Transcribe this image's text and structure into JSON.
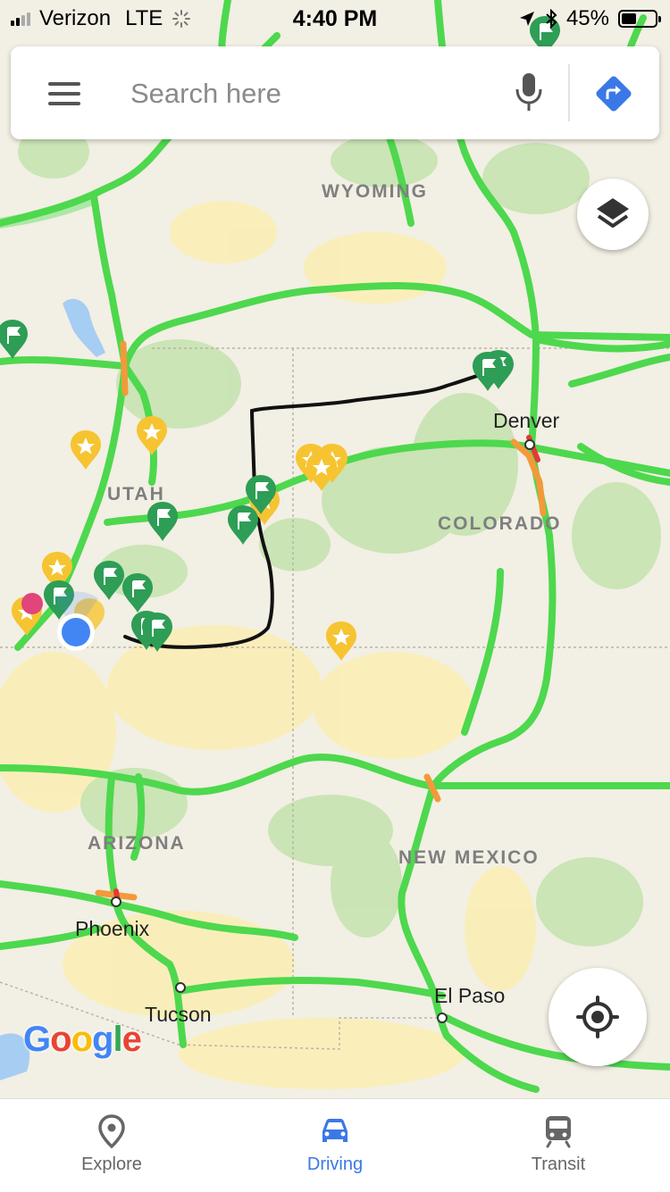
{
  "status_bar": {
    "carrier": "Verizon",
    "network": "LTE",
    "time": "4:40 PM",
    "battery": "45%",
    "battery_level": 0.45
  },
  "search": {
    "placeholder": "Search here"
  },
  "map": {
    "region_labels": {
      "wyoming": "WYOMING",
      "utah": "UTAH",
      "colorado": "COLORADO",
      "arizona": "ARIZONA",
      "new_mexico": "NEW MEXICO"
    },
    "cities": {
      "denver": "Denver",
      "phoenix": "Phoenix",
      "tucson": "Tucson",
      "el_paso": "El Paso"
    },
    "attribution": "Google",
    "colors": {
      "traffic_clear": "#4dd84d",
      "traffic_slow": "#f29a3a",
      "traffic_heavy": "#e53935",
      "saved_star": "#f6c431",
      "want_to_go_flag": "#2e9d55",
      "my_location": "#4285f4"
    }
  },
  "bottom_nav": {
    "explore": "Explore",
    "driving": "Driving",
    "transit": "Transit",
    "active": "Driving"
  }
}
